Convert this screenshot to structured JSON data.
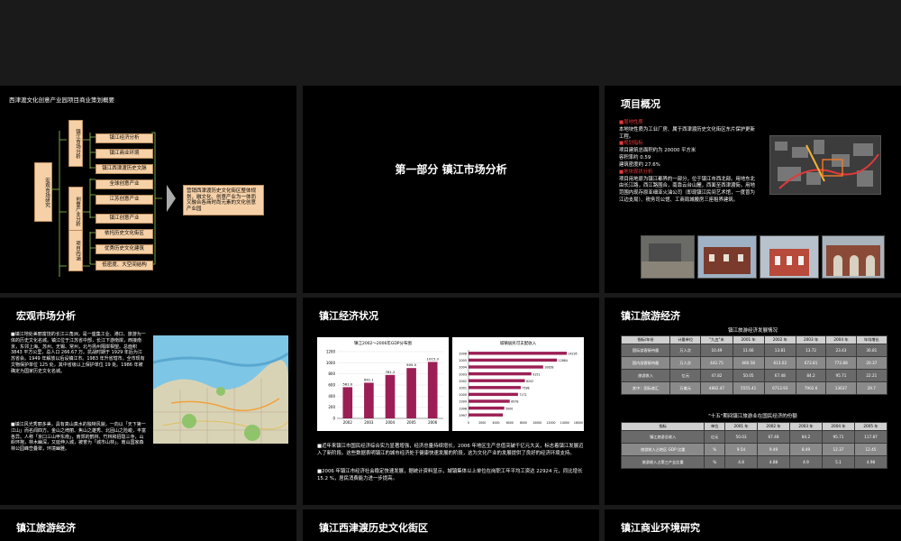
{
  "slides": {
    "s1": {
      "title": "西津渡文化创意产业园项目商业策划概要",
      "left_box": "宏观市场研究",
      "mid_labels": [
        "镇江市场分析",
        "创意产业分析",
        "项目内涵"
      ],
      "items": [
        "镇江经济分析",
        "镇江商业环境",
        "镇江西津渡历史文脉",
        "全球创意产业",
        "江苏创意产业",
        "镇江创意产业",
        "依托历史文化街区",
        "优秀历史文化建筑",
        "低密度、大空间结构"
      ],
      "result": "营销西津渡历史文化街区整体规划，融文化、创意产业为一体而又融合各商时尚元素的文化创意产业园"
    },
    "s2": {
      "heading": "第一部分  镇江市场分析"
    },
    "s3": {
      "title": "项目概况",
      "lines": [
        {
          "t": "■周地性质",
          "red": true
        },
        {
          "t": "本地块性质为工业厂房、属于西津渡历史文化街区东片保护更新工程。",
          "red": false
        },
        {
          "t": "■规划指标",
          "red": true
        },
        {
          "t": "项目建筑总面积约为 20000 平方米",
          "red": false
        },
        {
          "t": "容积率约 0.59",
          "red": false
        },
        {
          "t": "建筑密度约 27.6%",
          "red": false
        },
        {
          "t": "■地块现状分析",
          "red": true
        },
        {
          "t": "项目用地原为镇江都界的一部分，位于镇江市西北部。用地东北由长江路，西江路围合，南靠云台山麓，西面至西津渡街。用地范围内现存原亚细亚火油公司（即现镇江民间艺术馆，一度曾为江边支局）、税务司公馆、工商局城搬房三座租界建筑。",
          "red": false
        }
      ]
    },
    "s4": {
      "title": "宏观市场分析",
      "p1": "■镇江地处美丽富饶的长江三角洲，是一座集工业、港口、旅游为一体的历史文化名城。镇江位于江苏省中部，长江下游南岸，西接南京，东邻上海、苏州、无锡、常州，北与扬州隔岸相望。总面积 3843 平方公里，总人口 266.67 万。抗战时期于 1929 年后为江苏省会。1949 年解放以后设镇江市。1983 年升省辖市。全市现有文物保护单位 125 处，其中省级以上保护单位 19 处。1986 年被确定为国家历史文化名城。",
      "p2": "■镇江风光秀丽多美，具有真山真水的独特风貌，一向以「天下第一江山」而名闻四方。金山之绮丽、焦山之雄秀、北固山之险峻，丰富各异。人称「京口三山甲东南」，南郊的鹤林、竹林和招隐三寺，山岭环抱，林木幽深，又延伸入城，被誉为「城市山林」。南山国家森林公园峰峦叠翠，环境幽雅。"
    },
    "s5": {
      "title": "镇江经济状况",
      "bullet1": "■近年来镇江市国民经济综合实力显著增强，经济总量持续增长，2006 年地区生产总值突破千亿元大关，标志着镇江发展迈入了新阶段。这些数据表明镇江的城市经济处于健康快速发展的阶段，这为文化产业的发展提供了良好的经济环境支持。",
      "bullet2": "■2006 年镇江市经济社会稳定快速发展，据统计资料显示，城镇集体以上单位在岗职工年平均工资达 22924 元，同比增长 15.2 %，居民消费能力进一步提高。"
    },
    "s6": {
      "title": "镇江旅游经济",
      "table1_title": "镇江旅游经济发展情况",
      "table1_head": [
        "指标/年份",
        "计量单位",
        "\"九五\"末",
        "2001 年",
        "2002 年",
        "2003 年",
        "2004 年",
        "年均增长"
      ],
      "table1_rows": [
        [
          "国际游客接待量",
          "万人次",
          "10.49",
          "11.66",
          "13.81",
          "13.72",
          "23.43",
          "30.81"
        ],
        [
          "国内游客接待量",
          "万人次",
          "442.75",
          "460.58",
          "613.02",
          "672.81",
          "772.88",
          "20.37"
        ],
        [
          "旅游收入",
          "亿元",
          "47.82",
          "50.05",
          "67.48",
          "84.2",
          "95.71",
          "22.21"
        ],
        [
          "其中：国际收汇",
          "万美元",
          "4882.47",
          "5555.41",
          "6713.93",
          "7902.6",
          "13637",
          "29.7"
        ]
      ],
      "table2_title": "\"十五\"期间镇江旅游业在国民经济的份额",
      "table2_head": [
        "指标",
        "单位",
        "2001 年",
        "2002 年",
        "2003 年",
        "2004 年",
        "2005 年"
      ],
      "table2_rows": [
        [
          "镇江旅游总收入",
          "亿元",
          "50.03",
          "67.48",
          "84.2",
          "95.71",
          "117.87"
        ],
        [
          "旅游收入占地区 GDP 比重",
          "%",
          "9.54",
          "9.49",
          "8.49",
          "12.37",
          "12.45"
        ],
        [
          "旅游收入占第三产业比重",
          "%",
          "4.8",
          "4.88",
          "4.9",
          "5.1",
          "4.98"
        ]
      ]
    },
    "s7": {
      "title": "镇江旅游经济"
    },
    "s8": {
      "title": "镇江西津渡历史文化街区"
    },
    "s9": {
      "title": "镇江商业环境研究"
    }
  },
  "chart_data": [
    {
      "type": "bar",
      "title": "镇江2002～2006年GDP分布图",
      "categories": [
        "2002",
        "2003",
        "2004",
        "2005",
        "2006"
      ],
      "values": [
        561.0,
        641.1,
        781.2,
        905.0,
        1015.3
      ],
      "ylim": [
        0,
        1200
      ],
      "yticks": [
        0,
        200,
        400,
        600,
        800,
        1000,
        1200
      ],
      "color": "#9b1f55"
    },
    {
      "type": "bar",
      "orientation": "horizontal",
      "title": "城镇居民可支配收入",
      "categories": [
        "1997",
        "1998",
        "1999",
        "2000",
        "2001",
        "2002",
        "2003",
        "2004",
        "2005",
        "2006"
      ],
      "values": [
        5000,
        5200,
        6000,
        7200,
        7600,
        8200,
        9150,
        10858,
        12884,
        14295
      ],
      "value_labels": [
        "",
        "5000",
        "6978",
        "7172",
        "7598",
        "8202",
        "9151",
        "10858",
        "12884",
        "14295"
      ],
      "xlim": [
        0,
        16000
      ],
      "xticks": [
        0,
        2000,
        4000,
        6000,
        8000,
        10000,
        12000,
        14000,
        16000
      ],
      "color": "#9b1f55"
    }
  ]
}
